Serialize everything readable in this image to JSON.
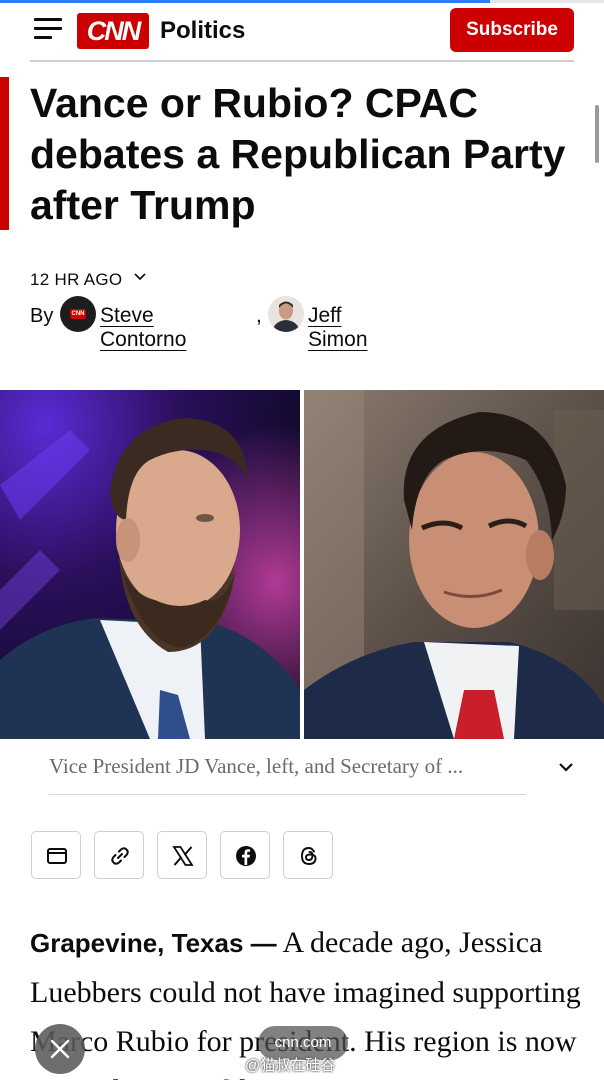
{
  "header": {
    "logo_text": "CNN",
    "section": "Politics",
    "subscribe_label": "Subscribe"
  },
  "article": {
    "headline": "Vance or Rubio? CPAC debates a Republican Party after Trump",
    "timestamp": "12 HR AGO",
    "byline_prefix": "By",
    "authors": [
      "Steve Contorno",
      "Jeff Simon"
    ],
    "author_separator": ",",
    "image_caption": "Vice President JD Vance, left, and Secretary of ...",
    "dateline": "Grapevine, Texas —",
    "body_text": "A decade ago, Jessica Luebbers could not have imagined supporting Marco Rubio for president. His region is now steeped in Donald"
  },
  "share_buttons": [
    {
      "icon": "mail-icon"
    },
    {
      "icon": "link-icon"
    },
    {
      "icon": "x-icon"
    },
    {
      "icon": "facebook-icon"
    },
    {
      "icon": "threads-icon"
    }
  ],
  "overlay": {
    "url_pill": "cnn.com",
    "watermark": "@猫叔在硅谷"
  },
  "colors": {
    "brand_red": "#cc0000",
    "progress_blue": "#2e7df6",
    "caption_gray": "#6b6b6b"
  }
}
